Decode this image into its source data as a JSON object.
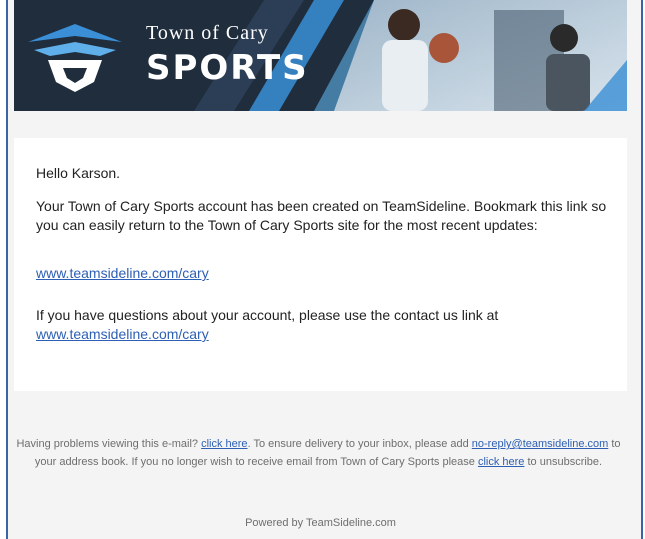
{
  "banner": {
    "town": "Town of Cary",
    "sports": "SPORTS"
  },
  "email": {
    "greeting": "Hello Karson.",
    "body_1": "Your Town of Cary Sports account has been created on TeamSideline. Bookmark this link so you can easily return to the Town of Cary Sports site for the most recent updates:",
    "link_1": "www.teamsideline.com/cary",
    "body_2": "If you have questions about your account, please use the contact us link at",
    "link_2": "www.teamsideline.com/cary"
  },
  "footer": {
    "t1": "Having problems viewing this e-mail? ",
    "click_here_1": "click here",
    "t2": ". To ensure delivery to your inbox, please add ",
    "email_link": "no-reply@teamsideline.com",
    "t3": " to your address book. If you no longer wish to receive email from Town of Cary Sports please ",
    "click_here_2": "click here",
    "t4": " to unsubscribe.",
    "powered": "Powered by TeamSideline.com"
  },
  "colors": {
    "banner_bg": "#1f2d3d",
    "accent_blue": "#3a8fd6",
    "link": "#2d5fb4"
  },
  "icons": [
    "town-of-cary-sports-logo-icon"
  ]
}
